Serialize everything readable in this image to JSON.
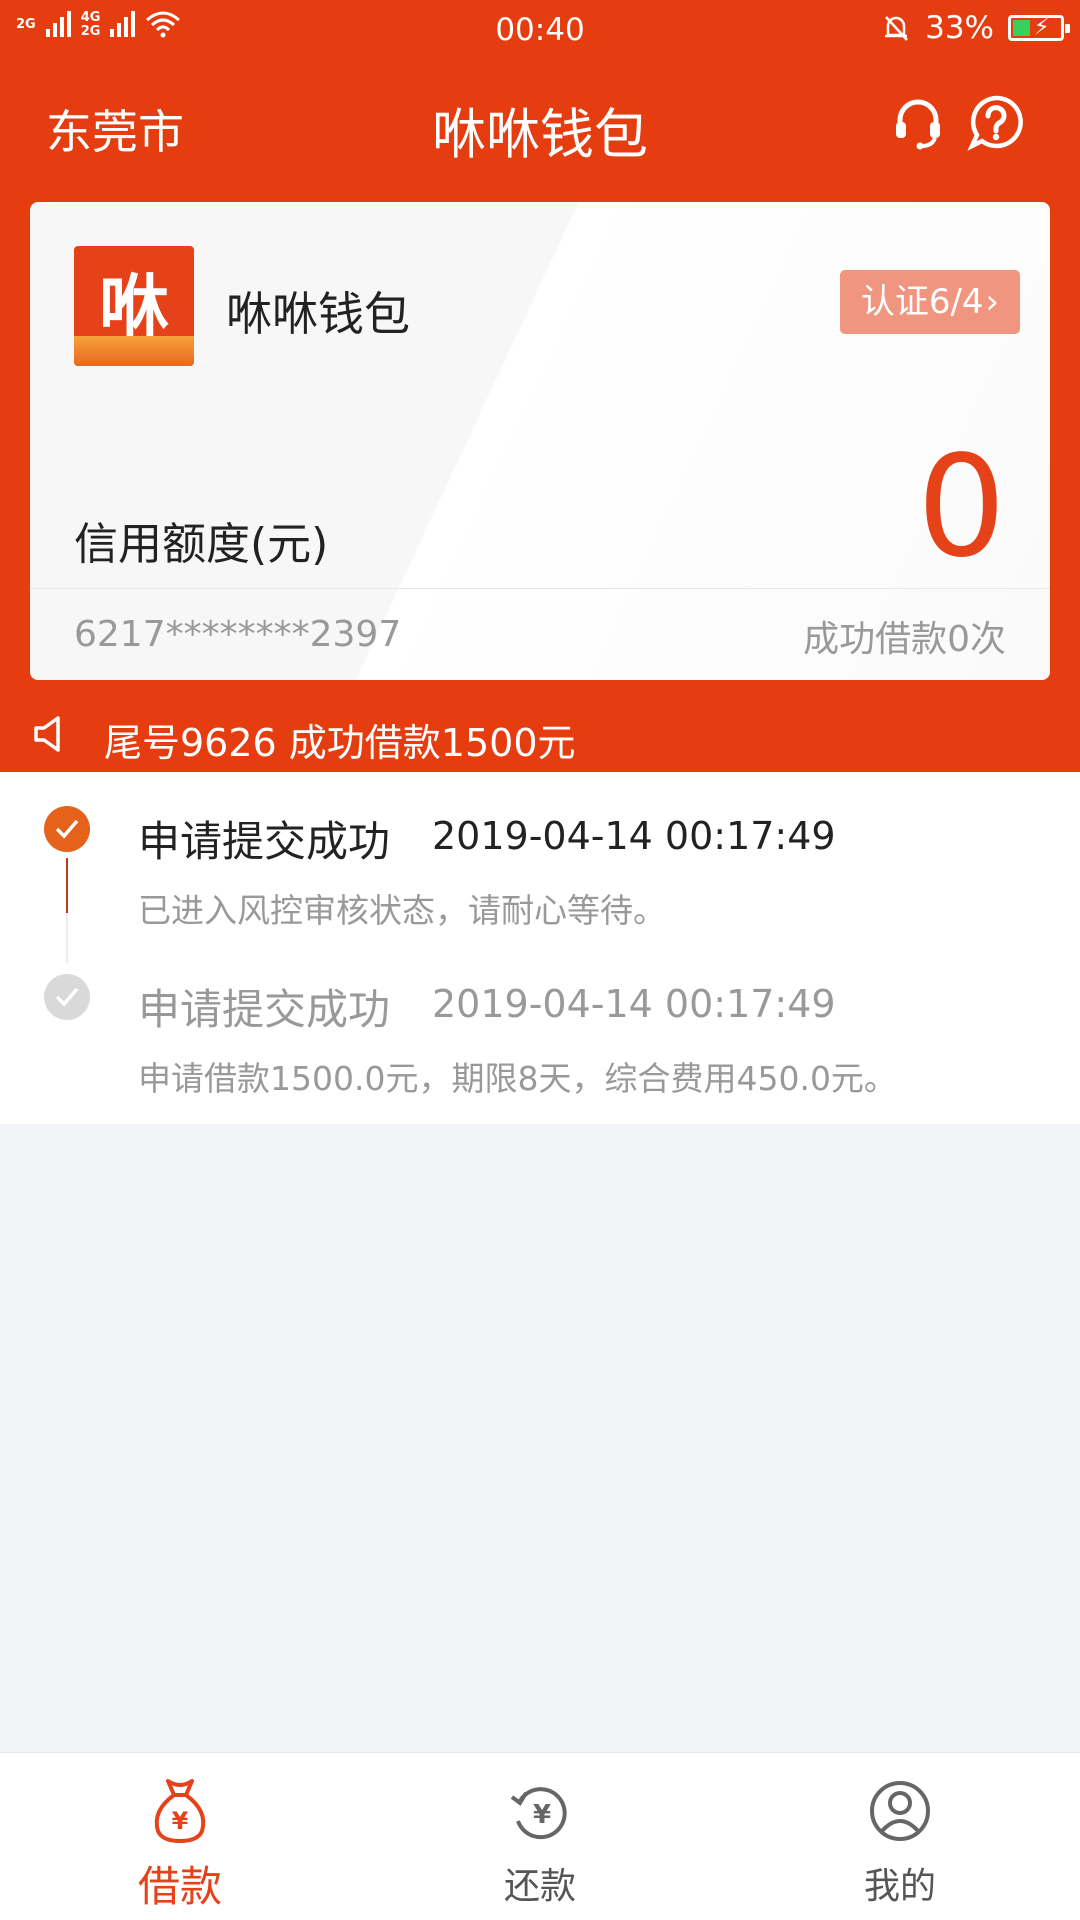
{
  "status_bar": {
    "network_left": "2G",
    "network_right_top": "4G",
    "network_right_bottom": "2G",
    "time": "00:40",
    "battery": "33%"
  },
  "header": {
    "city": "东莞市",
    "title": "咻咻钱包"
  },
  "card": {
    "logo_text": "咻",
    "name": "咻咻钱包",
    "cert_label": "认证6/4",
    "credit_label": "信用额度(元)",
    "credit_value": "0",
    "card_number": "6217********2397",
    "success_count": "成功借款0次"
  },
  "notice": {
    "text": "尾号9626 成功借款1500元"
  },
  "timeline": [
    {
      "title": "申请提交成功",
      "date": "2019-04-14 00:17:49",
      "desc": "已进入风控审核状态，请耐心等待。"
    },
    {
      "title": "申请提交成功",
      "date": "2019-04-14 00:17:49",
      "desc": "申请借款1500.0元，期限8天，综合费用450.0元。"
    }
  ],
  "tabs": [
    {
      "label": "借款"
    },
    {
      "label": "还款"
    },
    {
      "label": "我的"
    }
  ],
  "colors": {
    "brand": "#e53d10",
    "accent": "#e5421a",
    "cert_button": "#f09680",
    "battery_fill": "#36d05a"
  }
}
